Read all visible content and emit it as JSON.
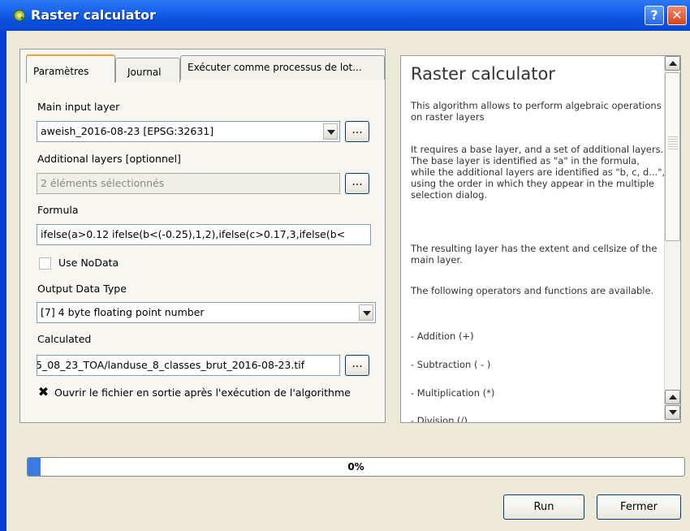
{
  "window": {
    "title": "Raster calculator",
    "help_button": "?",
    "close_button": "✕"
  },
  "tabs": [
    {
      "label": "Paramètres",
      "active": true
    },
    {
      "label": "Journal",
      "active": false
    },
    {
      "label": "Exécuter comme processus de lot...",
      "active": false
    }
  ],
  "form": {
    "main_input_label": "Main input layer",
    "main_input_value": "aweish_2016-08-23 [EPSG:32631]",
    "additional_label": "Additional layers [optionnel]",
    "additional_value": "2 éléments sélectionnés",
    "formula_label": "Formula",
    "formula_value": "ifelse(a>0.12 ifelse(b<(-0.25),1,2),ifelse(c>0.17,3,ifelse(b<",
    "use_nodata_label": "Use NoData",
    "use_nodata_checked": false,
    "output_type_label": "Output Data Type",
    "output_type_value": "[7] 4 byte floating point number",
    "calculated_label": "Calculated",
    "calculated_value": "5_08_23_TOA/landuse_8_classes_brut_2016-08-23.tif",
    "open_output_label": "Ouvrir le fichier en sortie après l'exécution de l'algorithme",
    "open_output_checked": true,
    "dots": "..."
  },
  "help": {
    "title": "Raster calculator",
    "paragraphs": [
      "This algorithm allows to perform algebraic operations on raster layers",
      "It requires a base layer, and a set of additional layers. The base layer is identified as \"a\" in the formula, while the additional layers are identified as \"b, c, d...\", using the order in which they appear in the multiple selection dialog.",
      "The resulting layer has the extent and cellsize of the main layer.",
      "The following operators and functions are available.",
      "- Addition (+)",
      "- Subtraction ( - )",
      "- Multiplication (*)",
      "- Division (/)"
    ]
  },
  "progress": {
    "value": 0.01,
    "text": "0%"
  },
  "buttons": {
    "run": "Run",
    "close": "Fermer"
  },
  "colors": {
    "titlebar": "#0a4fd9",
    "client_bg": "#ece9d8",
    "progress_fill": "#3a7bde"
  },
  "icons": {
    "app": "qgis-icon",
    "help": "help-icon",
    "close": "close-icon"
  }
}
